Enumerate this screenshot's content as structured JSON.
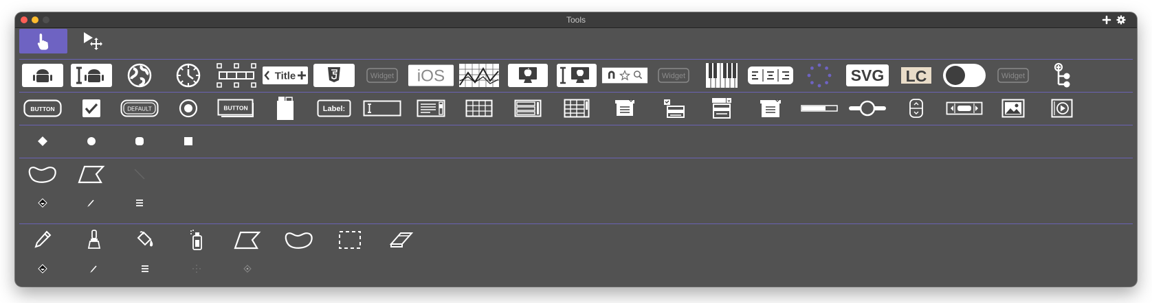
{
  "window": {
    "title": "Tools"
  },
  "colors": {
    "window_bg": "#525252",
    "titlebar_bg": "#3c3c3c",
    "accent": "#6e63c2",
    "separator": "#6a63b5",
    "close": "#ff5f57",
    "minimize": "#febc2e",
    "zoom": "#4f4f4f"
  },
  "titlebar_icons": [
    "plus-icon",
    "gear-icon"
  ],
  "pointer_tools": [
    {
      "name": "browse-tool",
      "icon": "hand-pointer-icon",
      "selected": true
    },
    {
      "name": "edit-tool",
      "icon": "arrow-move-icon",
      "selected": false
    }
  ],
  "widget_tools": [
    {
      "name": "android-button",
      "icon": "android-icon"
    },
    {
      "name": "android-field",
      "icon": "android-field-icon"
    },
    {
      "name": "browser",
      "icon": "globe-icon"
    },
    {
      "name": "clock",
      "icon": "clock-icon"
    },
    {
      "name": "segmented-widget",
      "icon": "segmented-icon"
    },
    {
      "name": "navigation-bar",
      "icon": "nav-bar-icon",
      "label": "Title"
    },
    {
      "name": "html5-widget",
      "icon": "html5-icon"
    },
    {
      "name": "widget-placeholder-1",
      "icon": "widget-badge-icon",
      "label": "Widget"
    },
    {
      "name": "ios-widget",
      "icon": "ios-icon",
      "label": "iOS"
    },
    {
      "name": "graph-widget",
      "icon": "graph-icon"
    },
    {
      "name": "mac-native",
      "icon": "mac-monitor-icon"
    },
    {
      "name": "mac-field",
      "icon": "mac-field-icon"
    },
    {
      "name": "search-rating",
      "icon": "search-rating-icon"
    },
    {
      "name": "widget-placeholder-2",
      "icon": "widget-badge-icon",
      "label": "Widget"
    },
    {
      "name": "piano-widget",
      "icon": "piano-icon"
    },
    {
      "name": "text-align-widget",
      "icon": "text-align-icon"
    },
    {
      "name": "spinner-widget",
      "icon": "spinner-icon"
    },
    {
      "name": "svg-widget",
      "icon": "svg-icon",
      "label": "SVG"
    },
    {
      "name": "livecode-widget",
      "icon": "lc-logo-icon",
      "label": "LC"
    },
    {
      "name": "switch-widget",
      "icon": "toggle-icon"
    },
    {
      "name": "widget-placeholder-3",
      "icon": "widget-badge-icon",
      "label": "Widget"
    },
    {
      "name": "tree-view-widget",
      "icon": "tree-icon"
    }
  ],
  "control_tools": [
    {
      "name": "push-button",
      "icon": "button-icon",
      "label": "BUTTON"
    },
    {
      "name": "checkbox",
      "icon": "checkbox-icon"
    },
    {
      "name": "default-button",
      "icon": "default-button-icon",
      "label": "DEFAULT"
    },
    {
      "name": "radio-button",
      "icon": "radio-icon"
    },
    {
      "name": "rectangle-button",
      "icon": "rect-button-icon",
      "label": "BUTTON"
    },
    {
      "name": "tab-panel",
      "icon": "tab-panel-icon"
    },
    {
      "name": "label-field",
      "icon": "label-field-icon",
      "label": "Label:"
    },
    {
      "name": "text-field",
      "icon": "text-field-icon"
    },
    {
      "name": "scrolling-field",
      "icon": "scrolling-field-icon"
    },
    {
      "name": "table-field",
      "icon": "table-field-icon"
    },
    {
      "name": "list-field",
      "icon": "list-field-icon"
    },
    {
      "name": "data-grid",
      "icon": "data-grid-icon"
    },
    {
      "name": "pulldown-menu",
      "icon": "pulldown-icon"
    },
    {
      "name": "option-menu",
      "icon": "option-menu-icon"
    },
    {
      "name": "combo-box",
      "icon": "combo-box-icon"
    },
    {
      "name": "popup-menu",
      "icon": "popup-menu-icon"
    },
    {
      "name": "progress-bar",
      "icon": "progress-bar-icon"
    },
    {
      "name": "slider",
      "icon": "slider-icon"
    },
    {
      "name": "little-arrows",
      "icon": "little-arrows-icon"
    },
    {
      "name": "scrollbar",
      "icon": "scrollbar-icon"
    },
    {
      "name": "image",
      "icon": "image-icon"
    },
    {
      "name": "player",
      "icon": "player-icon"
    }
  ],
  "shape_tools": [
    {
      "name": "diamond-marker",
      "icon": "diamond-icon"
    },
    {
      "name": "circle-marker",
      "icon": "circle-icon"
    },
    {
      "name": "rounded-marker",
      "icon": "rounded-square-icon"
    },
    {
      "name": "square-marker",
      "icon": "square-icon"
    }
  ],
  "vector_tools": [
    {
      "name": "curve-tool",
      "icon": "freeform-curve-icon"
    },
    {
      "name": "polygon-tool",
      "icon": "polygon-icon"
    },
    {
      "name": "line-tool",
      "icon": "line-icon"
    }
  ],
  "vector_options": [
    {
      "name": "fill-option",
      "icon": "fill-bucket-icon"
    },
    {
      "name": "stroke-option",
      "icon": "stroke-brush-icon"
    },
    {
      "name": "line-width-option",
      "icon": "line-width-icon"
    }
  ],
  "paint_tools": [
    {
      "name": "pencil-tool",
      "icon": "pencil-icon"
    },
    {
      "name": "brush-tool",
      "icon": "brush-icon"
    },
    {
      "name": "bucket-tool",
      "icon": "paint-bucket-icon"
    },
    {
      "name": "spray-tool",
      "icon": "spray-can-icon"
    },
    {
      "name": "paint-polygon-tool",
      "icon": "polygon-icon"
    },
    {
      "name": "paint-curve-tool",
      "icon": "freeform-curve-icon"
    },
    {
      "name": "select-tool",
      "icon": "marquee-icon"
    },
    {
      "name": "eraser-tool",
      "icon": "eraser-icon"
    }
  ],
  "paint_options": [
    {
      "name": "paint-fill-option",
      "icon": "fill-bucket-icon"
    },
    {
      "name": "paint-stroke-option",
      "icon": "stroke-brush-icon"
    },
    {
      "name": "paint-line-width-option",
      "icon": "line-width-icon"
    },
    {
      "name": "spray-option",
      "icon": "spray-dots-icon"
    },
    {
      "name": "brush-option",
      "icon": "brush-shape-icon"
    }
  ]
}
